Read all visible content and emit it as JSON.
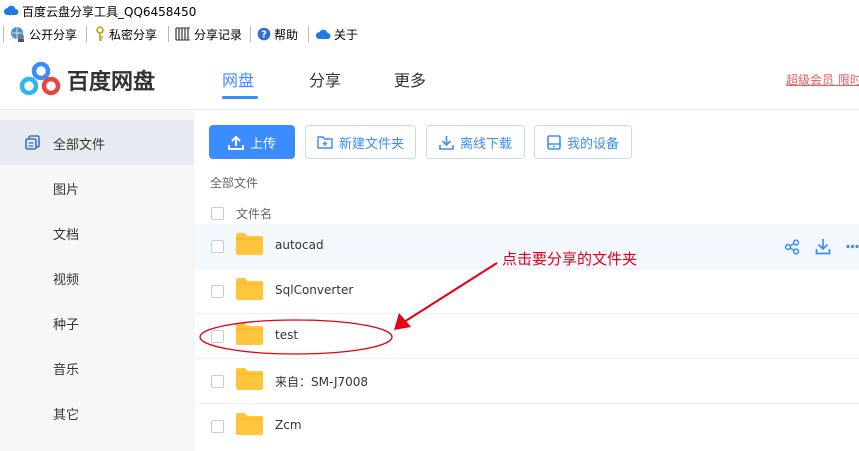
{
  "window": {
    "title": "百度云盘分享工具_QQ6458450"
  },
  "toolbar": [
    {
      "label": "公开分享",
      "icon": "globe-user-icon"
    },
    {
      "label": "私密分享",
      "icon": "key-icon"
    },
    {
      "label": "分享记录",
      "icon": "list-icon"
    },
    {
      "label": "帮助",
      "icon": "help-icon"
    },
    {
      "label": "关于",
      "icon": "cloud-icon"
    }
  ],
  "header": {
    "logo_text": "百度网盘",
    "nav": [
      {
        "label": "网盘",
        "active": true
      },
      {
        "label": "分享",
        "active": false
      },
      {
        "label": "更多",
        "active": false
      }
    ],
    "vip_link": "超级会员 限时"
  },
  "sidebar": {
    "items": [
      {
        "label": "全部文件",
        "active": true
      },
      {
        "label": "图片"
      },
      {
        "label": "文档"
      },
      {
        "label": "视频"
      },
      {
        "label": "种子"
      },
      {
        "label": "音乐"
      },
      {
        "label": "其它"
      }
    ]
  },
  "actions": {
    "upload": "上传",
    "new_folder": "新建文件夹",
    "offline_download": "离线下载",
    "my_devices": "我的设备"
  },
  "breadcrumb": "全部文件",
  "list": {
    "column_name": "文件名",
    "rows": [
      {
        "name": "autocad",
        "hover": true
      },
      {
        "name": "SqlConverter"
      },
      {
        "name": "test",
        "highlighted": true
      },
      {
        "name": "来自：SM-J7008"
      },
      {
        "name": "Zcm"
      }
    ]
  },
  "annotation": {
    "text": "点击要分享的文件夹",
    "color": "#e60012"
  },
  "colors": {
    "accent": "#3b8cff",
    "folder": "#ffc53d",
    "vip": "#f25a5a"
  }
}
